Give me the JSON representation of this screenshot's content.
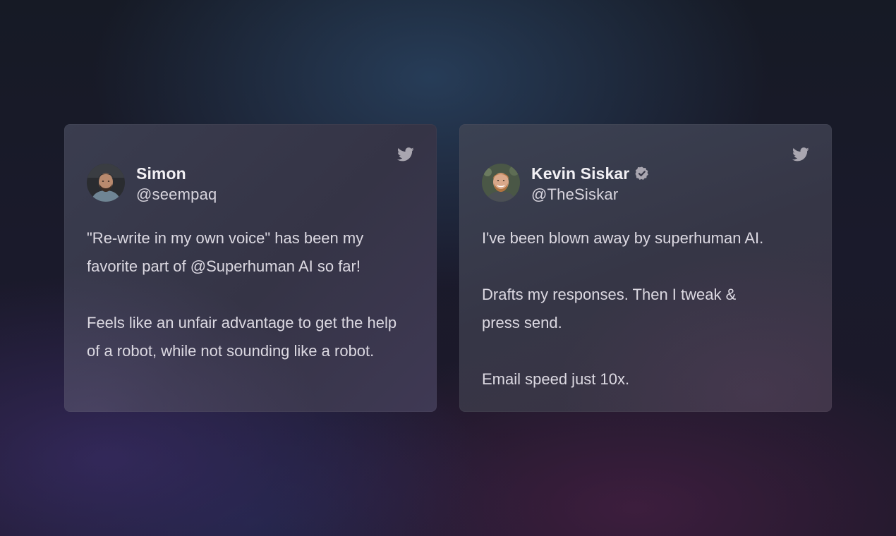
{
  "testimonials": [
    {
      "name": "Simon",
      "handle": "@seempaq",
      "verified": false,
      "source_icon": "twitter-icon",
      "paragraphs": [
        "\"Re-write in my own voice\" has been my favorite part of @Superhuman AI so far!",
        "Feels like an unfair advantage to get the help of a robot, while not sounding like a robot."
      ]
    },
    {
      "name": "Kevin Siskar",
      "handle": "@TheSiskar",
      "verified": true,
      "source_icon": "twitter-icon",
      "paragraphs": [
        "I've been blown away by superhuman AI.",
        "Drafts my responses. Then I tweak & press send.",
        "Email speed just 10x."
      ]
    }
  ],
  "colors": {
    "card_text": "#dcd9e2",
    "name_text": "#f2f0f4",
    "icon_gray": "#a9a6b0"
  }
}
